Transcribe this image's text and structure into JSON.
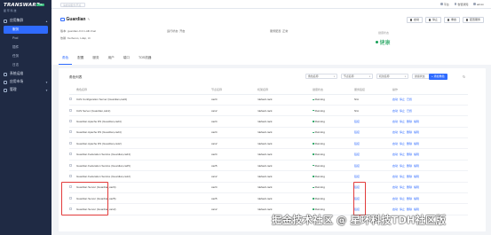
{
  "app": {
    "logo_title": "TRANSWARP",
    "logo_sub": "星 环 科 技",
    "logo_badge": "TDH",
    "top_search_placeholder": "请搜索服务/节点",
    "top_links": [
      "平台",
      "告警通知",
      "admin"
    ]
  },
  "sidebar": {
    "groups": [
      {
        "label": "应用集群",
        "items": [
          {
            "label": "服务",
            "active": true
          },
          {
            "label": "Pod",
            "active": false
          },
          {
            "label": "插件",
            "active": false
          },
          {
            "label": "任务",
            "active": false
          },
          {
            "label": "日志",
            "active": false
          }
        ]
      },
      {
        "label": "系统运维",
        "items": []
      },
      {
        "label": "应用市场",
        "items": []
      },
      {
        "label": "管理",
        "items": []
      }
    ]
  },
  "header": {
    "service_name": "Guardian",
    "edit_icon": "✎",
    "meta": [
      {
        "label": "版本:",
        "value": "guardian-0.0.1-tdh-final"
      },
      {
        "label": "运行状态:",
        "value": "开启"
      },
      {
        "label": "服务配置:",
        "value": "正常"
      },
      {
        "label": "依赖:",
        "value": "Kerberos, Ldap, Ui"
      }
    ],
    "health_label": "健康状态",
    "health_value": "健康",
    "actions": [
      "启动",
      "停止",
      "重启",
      "配置服务"
    ],
    "tabs": [
      "角色",
      "配置",
      "服务",
      "用户",
      "端口",
      "TOS机器"
    ],
    "active_tab": 0
  },
  "panel": {
    "title": "角色列表",
    "filters": [
      "角色名称",
      "节点名称",
      "机架名称",
      "健康状态"
    ],
    "add_button": "+ 添加角色",
    "refresh_icon": "↻",
    "columns": [
      "角色名称",
      "节点名称",
      "机架名称",
      "健康状态",
      "服务链接",
      "操作"
    ],
    "rows": [
      {
        "name": "CAS Configuration Server (Guardian,ca24)",
        "node": "ca24",
        "rack": "/default-rack",
        "status": "Running",
        "link": "N/A",
        "ops": [
          "启动",
          "停止",
          "已终"
        ]
      },
      {
        "name": "CAS Server (Guardian,ca12)",
        "node": "ca12",
        "rack": "/default-rack",
        "status": "Running",
        "link": "N/A",
        "ops": [
          "启动",
          "停止",
          "已终"
        ]
      },
      {
        "name": "Guardian Apache DS (Guardian,ca24)",
        "node": "ca24",
        "rack": "/default-rack",
        "status": "Running",
        "link": "链接",
        "ops": [
          "启动",
          "停止",
          "删除",
          "编辑"
        ]
      },
      {
        "name": "Guardian Apache DS (Guardian,ca24)",
        "node": "ca24",
        "rack": "/default-rack",
        "status": "Running",
        "link": "链接",
        "ops": [
          "启动",
          "停止",
          "删除",
          "编辑"
        ]
      },
      {
        "name": "Guardian Apache DS (Guardian,ca12)",
        "node": "ca12",
        "rack": "/default-rack",
        "status": "Running",
        "link": "链接",
        "ops": [
          "启动",
          "停止",
          "删除",
          "编辑"
        ]
      },
      {
        "name": "Guardian Federation Service (Guardian,ca24)",
        "node": "ca24",
        "rack": "/default-rack",
        "status": "Running",
        "link": "链接",
        "ops": [
          "启动",
          "停止",
          "删除",
          "编辑"
        ]
      },
      {
        "name": "Guardian Federation Service (Guardian,ca25)",
        "node": "ca25",
        "rack": "/default-rack",
        "status": "Running",
        "link": "链接",
        "ops": [
          "启动",
          "停止",
          "删除",
          "编辑"
        ]
      },
      {
        "name": "Guardian Federation Service (Guardian,ca12)",
        "node": "ca12",
        "rack": "/default-rack",
        "status": "Running",
        "link": "链接",
        "ops": [
          "启动",
          "停止",
          "删除",
          "编辑"
        ]
      },
      {
        "name": "Guardian Server (Guardian,ca24)",
        "node": "ca24",
        "rack": "/default-rack",
        "status": "Running",
        "link": "链接",
        "ops": [
          "启动",
          "停止",
          "删除",
          "编辑"
        ]
      },
      {
        "name": "Guardian Server (Guardian,ca25)",
        "node": "ca25",
        "rack": "/default-rack",
        "status": "Running",
        "link": "链接",
        "ops": [
          "启动",
          "停止",
          "删除",
          "编辑"
        ]
      },
      {
        "name": "Guardian Server (Guardian,ca12)",
        "node": "ca12",
        "rack": "/default-rack",
        "status": "Running",
        "link": "链接",
        "ops": [
          "启动",
          "停止",
          "删除",
          "编辑"
        ]
      }
    ]
  },
  "watermark": "掘金技术社区 @ 星环科技TDH社区版",
  "colors": {
    "accent": "#2f6bff",
    "sidebar_bg": "#1f2a44",
    "healthy": "#18a058",
    "highlight": "#e23b3b"
  }
}
